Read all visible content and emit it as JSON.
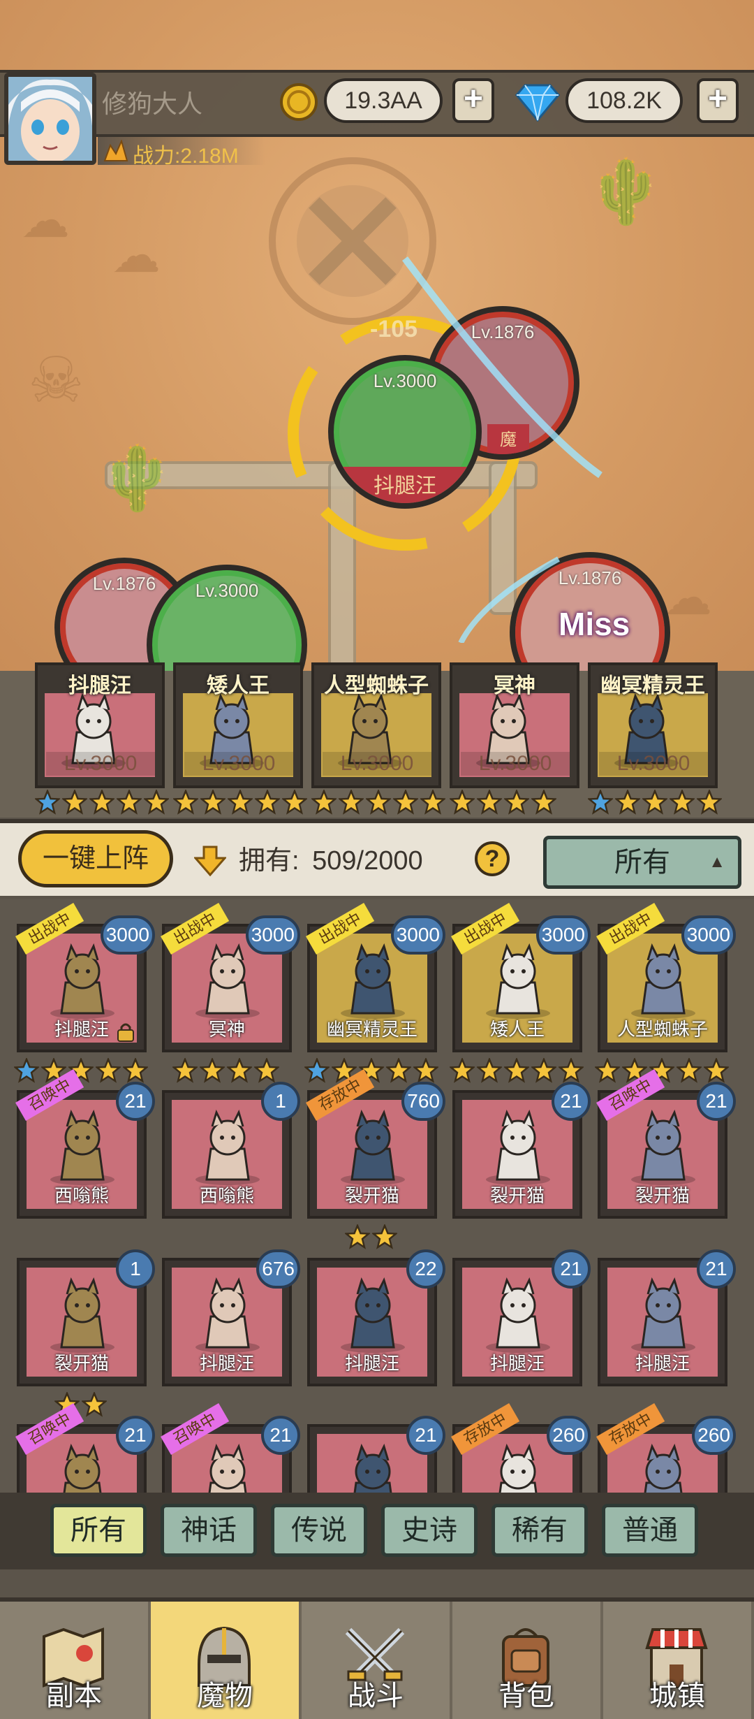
{
  "player": {
    "name": "修狗大人",
    "power": "战力:2.18M",
    "gold": "19.3AA",
    "gems": "108.2K"
  },
  "battle": {
    "floating_text": "-105",
    "miss_text": "Miss",
    "units": [
      {
        "level": "Lv.3000",
        "name": "抖腿汪",
        "ring": "#4caf4a",
        "fill": "#5fa85a"
      },
      {
        "level": "Lv.1876",
        "name": "魔",
        "ring": "#c0392b",
        "fill": "#b0767c"
      },
      {
        "level": "Lv.1876",
        "name": "",
        "ring": "#c0392b",
        "fill": "#c98d8f"
      },
      {
        "level": "Lv.3000",
        "name": "",
        "ring": "#4caf4a",
        "fill": "#6ab366"
      },
      {
        "level": "Lv.1876",
        "name": "",
        "ring": "#c0392b",
        "fill": "#d09a90"
      }
    ]
  },
  "formation": [
    {
      "name": "抖腿汪",
      "level": "Lv.3000",
      "bg": "#c9707a",
      "stars": 5,
      "blue_stars": 1
    },
    {
      "name": "矮人王",
      "level": "Lv.3000",
      "bg": "#c9a84a",
      "stars": 5,
      "blue_stars": 0
    },
    {
      "name": "人型蜘蛛子",
      "level": "Lv.3000",
      "bg": "#c9a84a",
      "stars": 5,
      "blue_stars": 0
    },
    {
      "name": "冥神",
      "level": "Lv.3000",
      "bg": "#c9707a",
      "stars": 4,
      "blue_stars": 0
    },
    {
      "name": "幽冥精灵王",
      "level": "Lv.3000",
      "bg": "#c9a84a",
      "stars": 5,
      "blue_stars": 1
    }
  ],
  "controls": {
    "deploy_label": "一键上阵",
    "owned_label": "拥有:",
    "owned_value": "509/2000",
    "help_label": "?",
    "filter_label": "所有"
  },
  "roster": [
    {
      "name": "抖腿汪",
      "count": "3000",
      "tag": "出战中",
      "bg": "#c9707a",
      "stars": 5,
      "blue_stars": 1
    },
    {
      "name": "冥神",
      "count": "3000",
      "tag": "出战中",
      "bg": "#c9707a",
      "stars": 4,
      "blue_stars": 0
    },
    {
      "name": "幽冥精灵王",
      "count": "3000",
      "tag": "出战中",
      "bg": "#c9a84a",
      "stars": 5,
      "blue_stars": 1
    },
    {
      "name": "矮人王",
      "count": "3000",
      "tag": "出战中",
      "bg": "#c9a84a",
      "stars": 5,
      "blue_stars": 0
    },
    {
      "name": "人型蜘蛛子",
      "count": "3000",
      "tag": "出战中",
      "bg": "#c9a84a",
      "stars": 5,
      "blue_stars": 0
    },
    {
      "name": "西嗡熊",
      "count": "21",
      "tag": "召唤中",
      "bg": "#c9707a",
      "stars": 0,
      "blue_stars": 0
    },
    {
      "name": "西嗡熊",
      "count": "1",
      "tag": "",
      "bg": "#c9707a",
      "stars": 0,
      "blue_stars": 0
    },
    {
      "name": "裂开猫",
      "count": "760",
      "tag": "存放中",
      "bg": "#c9707a",
      "stars": 2,
      "blue_stars": 0
    },
    {
      "name": "裂开猫",
      "count": "21",
      "tag": "",
      "bg": "#c9707a",
      "stars": 0,
      "blue_stars": 0
    },
    {
      "name": "裂开猫",
      "count": "21",
      "tag": "召唤中",
      "bg": "#c9707a",
      "stars": 0,
      "blue_stars": 0
    },
    {
      "name": "裂开猫",
      "count": "1",
      "tag": "",
      "bg": "#c9707a",
      "stars": 2,
      "blue_stars": 0
    },
    {
      "name": "抖腿汪",
      "count": "676",
      "tag": "",
      "bg": "#c9707a",
      "stars": 0,
      "blue_stars": 0
    },
    {
      "name": "抖腿汪",
      "count": "22",
      "tag": "",
      "bg": "#c9707a",
      "stars": 0,
      "blue_stars": 0
    },
    {
      "name": "抖腿汪",
      "count": "21",
      "tag": "",
      "bg": "#c9707a",
      "stars": 0,
      "blue_stars": 0
    },
    {
      "name": "抖腿汪",
      "count": "21",
      "tag": "",
      "bg": "#c9707a",
      "stars": 0,
      "blue_stars": 0
    },
    {
      "name": "",
      "count": "21",
      "tag": "召唤中",
      "bg": "#c9707a",
      "stars": 0,
      "blue_stars": 0
    },
    {
      "name": "",
      "count": "21",
      "tag": "召唤中",
      "bg": "#c9707a",
      "stars": 0,
      "blue_stars": 0
    },
    {
      "name": "",
      "count": "21",
      "tag": "",
      "bg": "#c9707a",
      "stars": 0,
      "blue_stars": 0
    },
    {
      "name": "",
      "count": "260",
      "tag": "存放中",
      "bg": "#c9707a",
      "stars": 0,
      "blue_stars": 0
    },
    {
      "name": "",
      "count": "260",
      "tag": "存放中",
      "bg": "#c9707a",
      "stars": 0,
      "blue_stars": 0
    }
  ],
  "tag_colors": {
    "出战中": "#f5dc3c",
    "召唤中": "#e56fe8",
    "存放中": "#f0953a"
  },
  "rarity_tabs": [
    "所有",
    "神话",
    "传说",
    "史诗",
    "稀有",
    "普通"
  ],
  "nav": [
    {
      "label": "副本",
      "icon": "map-icon"
    },
    {
      "label": "魔物",
      "icon": "monster-helmet-icon"
    },
    {
      "label": "战斗",
      "icon": "crossed-swords-icon"
    },
    {
      "label": "背包",
      "icon": "backpack-icon"
    },
    {
      "label": "城镇",
      "icon": "town-shop-icon"
    }
  ],
  "active_nav": 1,
  "colors": {
    "star_gold": "#f5c33b",
    "star_blue": "#4fa3e0",
    "accent_yellow": "#f1c13c"
  }
}
